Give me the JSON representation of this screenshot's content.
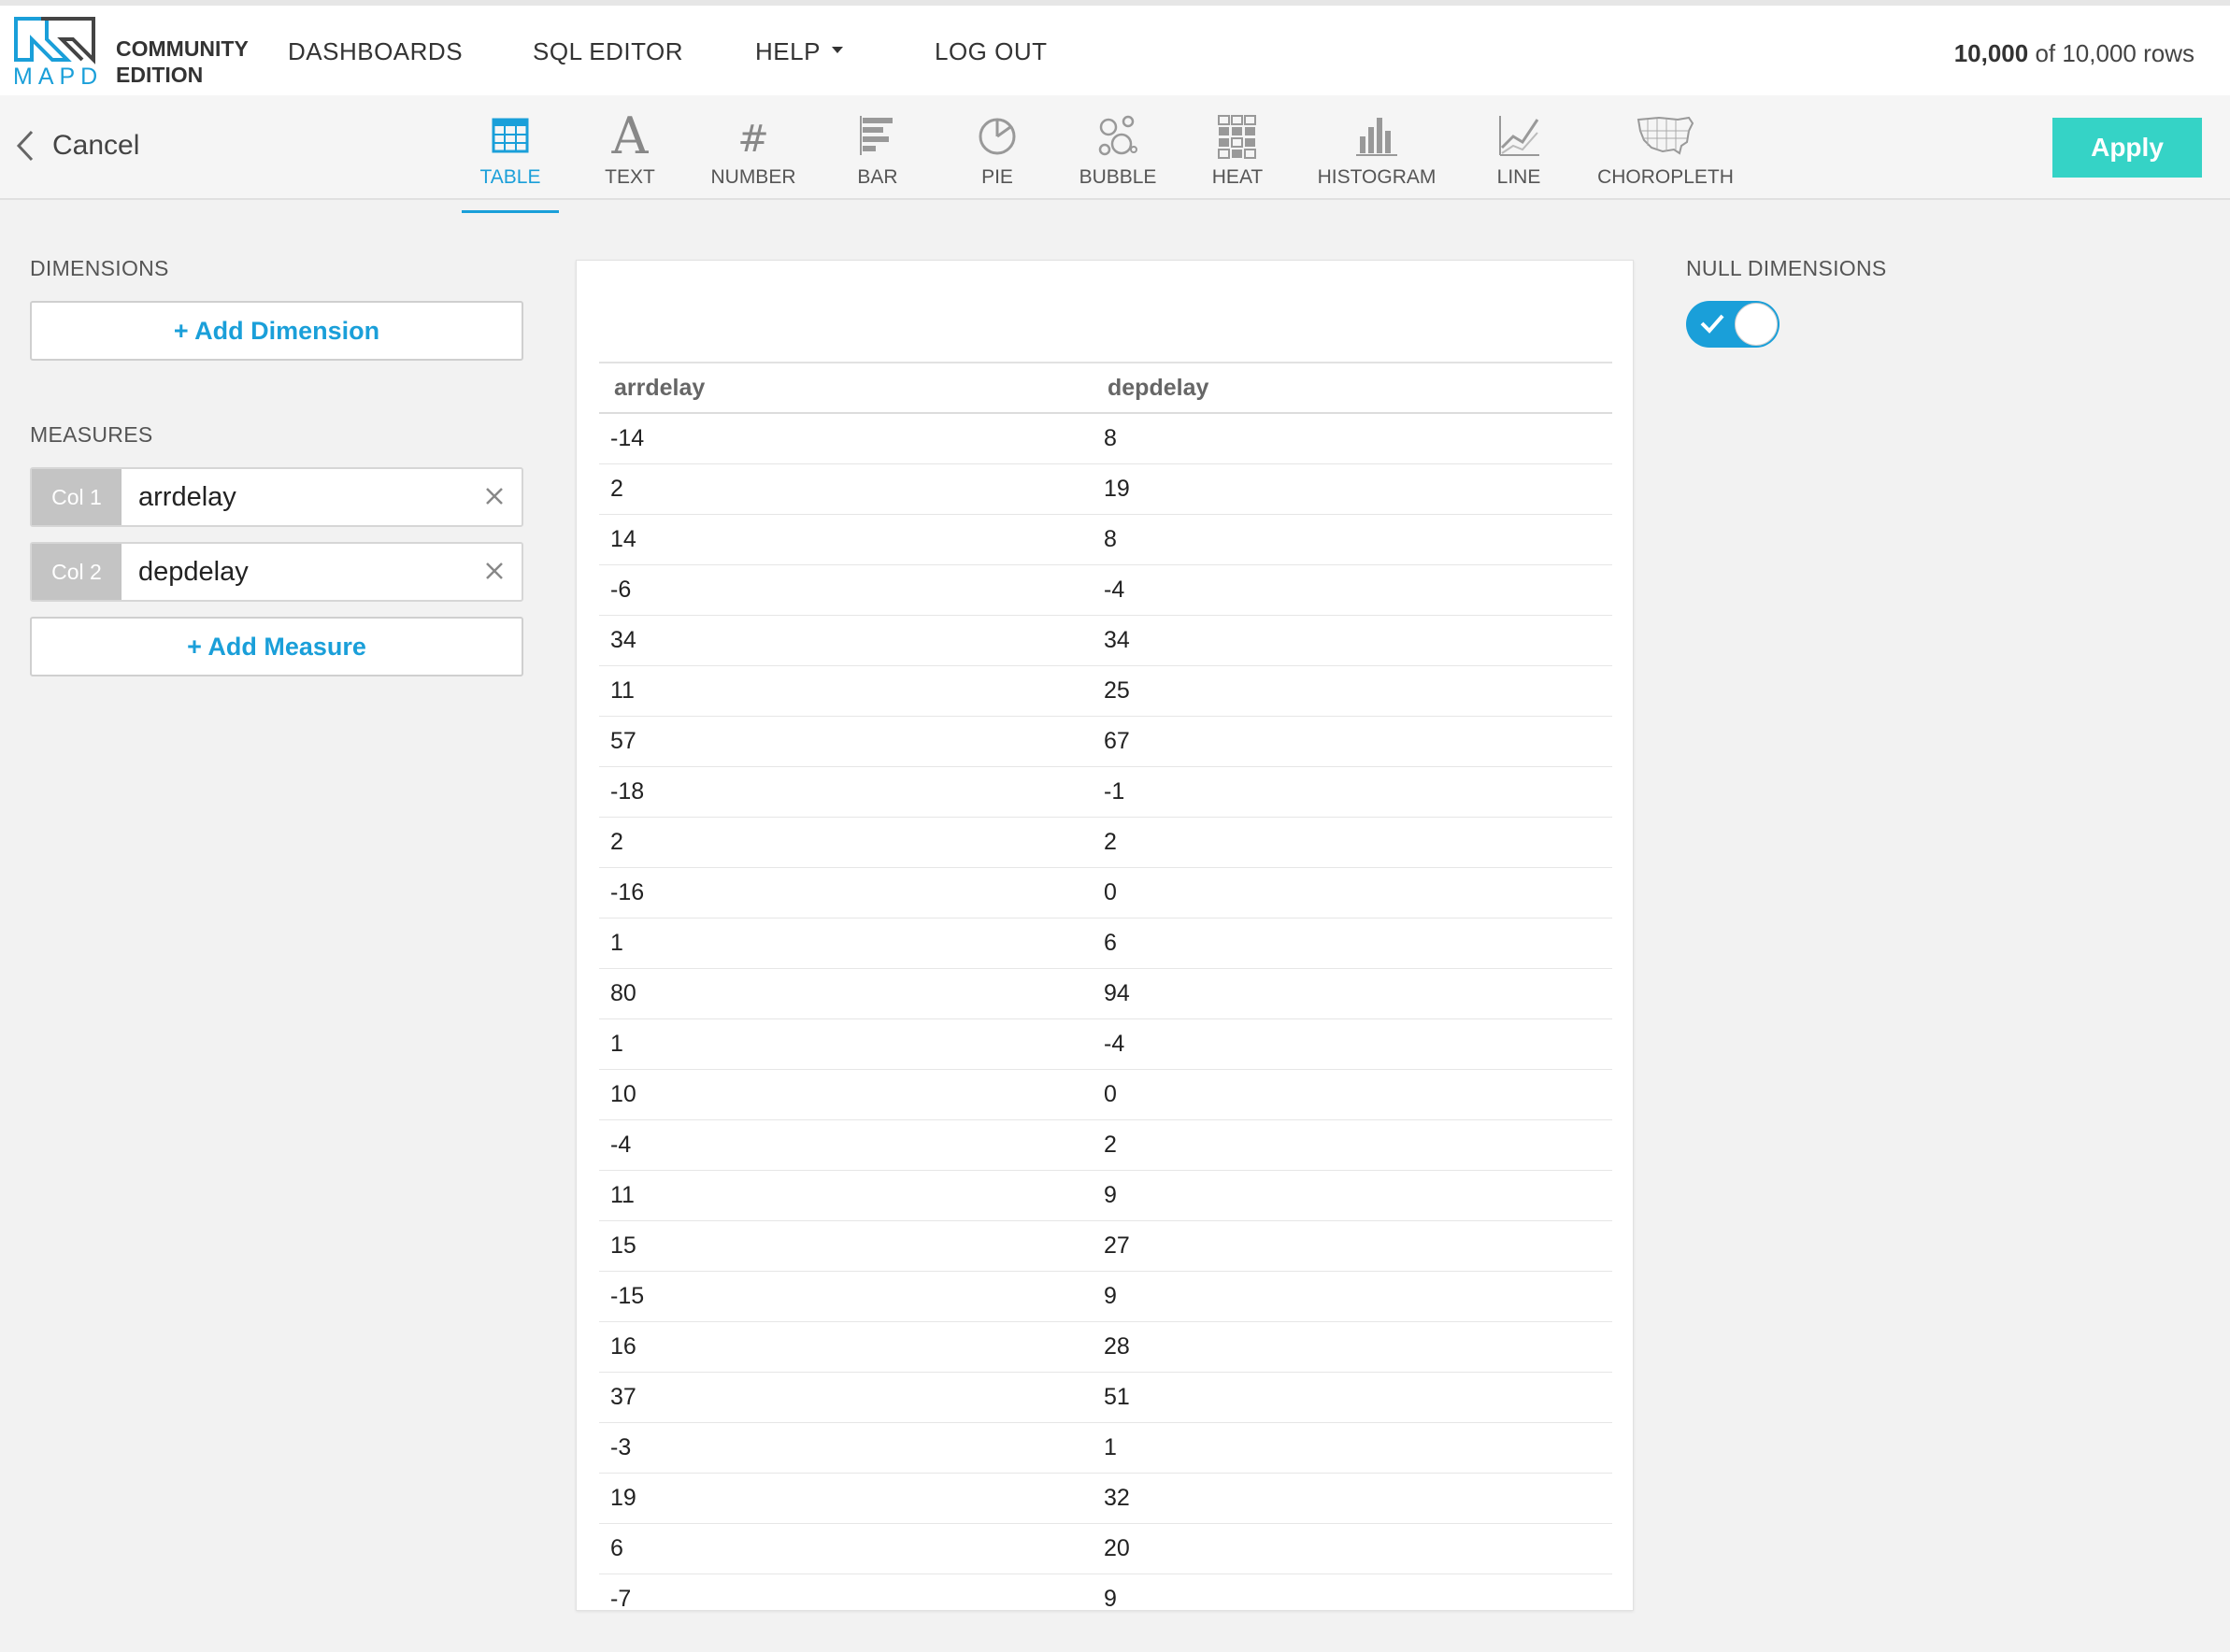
{
  "app": {
    "logo_text": "MAPD",
    "edition_line1": "COMMUNITY",
    "edition_line2": "EDITION"
  },
  "nav": {
    "dashboards": "DASHBOARDS",
    "sql_editor": "SQL EDITOR",
    "help": "HELP",
    "logout": "LOG OUT"
  },
  "rowcount": {
    "shown": "10,000",
    "rest": " of 10,000 rows"
  },
  "toolbar": {
    "cancel": "Cancel",
    "apply": "Apply",
    "chart_types": [
      {
        "label": "TABLE",
        "icon": "table-icon",
        "active": true
      },
      {
        "label": "TEXT",
        "icon": "text-icon"
      },
      {
        "label": "NUMBER",
        "icon": "hash-icon"
      },
      {
        "label": "BAR",
        "icon": "bar-chart-icon"
      },
      {
        "label": "PIE",
        "icon": "pie-chart-icon"
      },
      {
        "label": "BUBBLE",
        "icon": "bubble-chart-icon"
      },
      {
        "label": "HEAT",
        "icon": "heatmap-icon"
      },
      {
        "label": "HISTOGRAM",
        "icon": "histogram-icon"
      },
      {
        "label": "LINE",
        "icon": "line-chart-icon"
      },
      {
        "label": "CHOROPLETH",
        "icon": "usa-map-icon"
      }
    ]
  },
  "left": {
    "dimensions_label": "DIMENSIONS",
    "add_dimension": "+ Add Dimension",
    "measures_label": "MEASURES",
    "measures": [
      {
        "tag": "Col 1",
        "name": "arrdelay"
      },
      {
        "tag": "Col 2",
        "name": "depdelay"
      }
    ],
    "add_measure": "+ Add Measure"
  },
  "right": {
    "null_dimensions_label": "NULL DIMENSIONS",
    "null_dimensions_on": true
  },
  "colors": {
    "accent": "#1a9fd9",
    "apply": "#35d3c6"
  },
  "table": {
    "columns": [
      "arrdelay",
      "depdelay"
    ],
    "rows": [
      [
        "-14",
        "8"
      ],
      [
        "2",
        "19"
      ],
      [
        "14",
        "8"
      ],
      [
        "-6",
        "-4"
      ],
      [
        "34",
        "34"
      ],
      [
        "11",
        "25"
      ],
      [
        "57",
        "67"
      ],
      [
        "-18",
        "-1"
      ],
      [
        "2",
        "2"
      ],
      [
        "-16",
        "0"
      ],
      [
        "1",
        "6"
      ],
      [
        "80",
        "94"
      ],
      [
        "1",
        "-4"
      ],
      [
        "10",
        "0"
      ],
      [
        "-4",
        "2"
      ],
      [
        "11",
        "9"
      ],
      [
        "15",
        "27"
      ],
      [
        "-15",
        "9"
      ],
      [
        "16",
        "28"
      ],
      [
        "37",
        "51"
      ],
      [
        "-3",
        "1"
      ],
      [
        "19",
        "32"
      ],
      [
        "6",
        "20"
      ],
      [
        "-7",
        "9"
      ]
    ]
  }
}
